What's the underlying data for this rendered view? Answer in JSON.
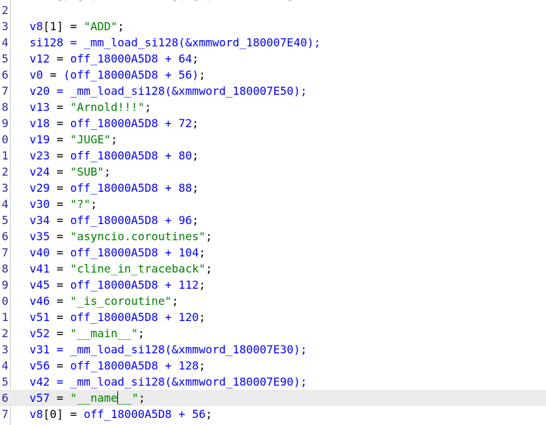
{
  "colors": {
    "background": "#ffffff",
    "variable": "#0000ff",
    "string": "#008000",
    "operator": "#000000",
    "line_number": "#2a2a96",
    "current_line": "#ebebeb"
  },
  "top_partial": "    ], [ ,           ], [ ,           ]",
  "lines": [
    {
      "num": "2",
      "tokens": []
    },
    {
      "num": "3",
      "tokens": [
        {
          "t": "v8",
          "c": "var"
        },
        {
          "t": "[1] = ",
          "c": "op"
        },
        {
          "t": "\"ADD\"",
          "c": "str"
        },
        {
          "t": ";",
          "c": "op"
        }
      ]
    },
    {
      "num": "4",
      "tokens": [
        {
          "t": "si128",
          "c": "var"
        },
        {
          "t": " = _mm_load_si128(&xmmword_180007E40);",
          "c": "var"
        }
      ]
    },
    {
      "num": "5",
      "tokens": [
        {
          "t": "v12",
          "c": "var"
        },
        {
          "t": " = ",
          "c": "op"
        },
        {
          "t": "off_18000A5D8 + 64",
          "c": "var"
        },
        {
          "t": ";",
          "c": "op"
        }
      ]
    },
    {
      "num": "6",
      "tokens": [
        {
          "t": "v0",
          "c": "var"
        },
        {
          "t": " = ",
          "c": "op"
        },
        {
          "t": "(off_18000A5D8 + 56)",
          "c": "var"
        },
        {
          "t": ";",
          "c": "op"
        }
      ]
    },
    {
      "num": "7",
      "tokens": [
        {
          "t": "v20",
          "c": "var"
        },
        {
          "t": " = _mm_load_si128(&xmmword_180007E50);",
          "c": "var"
        }
      ]
    },
    {
      "num": "8",
      "tokens": [
        {
          "t": "v13",
          "c": "var"
        },
        {
          "t": " = ",
          "c": "op"
        },
        {
          "t": "\"Arnold!!!\"",
          "c": "str"
        },
        {
          "t": ";",
          "c": "op"
        }
      ]
    },
    {
      "num": "9",
      "tokens": [
        {
          "t": "v18",
          "c": "var"
        },
        {
          "t": " = ",
          "c": "op"
        },
        {
          "t": "off_18000A5D8 + 72",
          "c": "var"
        },
        {
          "t": ";",
          "c": "op"
        }
      ]
    },
    {
      "num": "0",
      "tokens": [
        {
          "t": "v19",
          "c": "var"
        },
        {
          "t": " = ",
          "c": "op"
        },
        {
          "t": "\"JUGE\"",
          "c": "str"
        },
        {
          "t": ";",
          "c": "op"
        }
      ]
    },
    {
      "num": "1",
      "tokens": [
        {
          "t": "v23",
          "c": "var"
        },
        {
          "t": " = ",
          "c": "op"
        },
        {
          "t": "off_18000A5D8 + 80",
          "c": "var"
        },
        {
          "t": ";",
          "c": "op"
        }
      ]
    },
    {
      "num": "2",
      "tokens": [
        {
          "t": "v24",
          "c": "var"
        },
        {
          "t": " = ",
          "c": "op"
        },
        {
          "t": "\"SUB\"",
          "c": "str"
        },
        {
          "t": ";",
          "c": "op"
        }
      ]
    },
    {
      "num": "3",
      "tokens": [
        {
          "t": "v29",
          "c": "var"
        },
        {
          "t": " = ",
          "c": "op"
        },
        {
          "t": "off_18000A5D8 + 88",
          "c": "var"
        },
        {
          "t": ";",
          "c": "op"
        }
      ]
    },
    {
      "num": "4",
      "tokens": [
        {
          "t": "v30",
          "c": "var"
        },
        {
          "t": " = ",
          "c": "op"
        },
        {
          "t": "\"?\"",
          "c": "str"
        },
        {
          "t": ";",
          "c": "op"
        }
      ]
    },
    {
      "num": "5",
      "tokens": [
        {
          "t": "v34",
          "c": "var"
        },
        {
          "t": " = ",
          "c": "op"
        },
        {
          "t": "off_18000A5D8 + 96",
          "c": "var"
        },
        {
          "t": ";",
          "c": "op"
        }
      ]
    },
    {
      "num": "6",
      "tokens": [
        {
          "t": "v35",
          "c": "var"
        },
        {
          "t": " = ",
          "c": "op"
        },
        {
          "t": "\"asyncio.coroutines\"",
          "c": "str"
        },
        {
          "t": ";",
          "c": "op"
        }
      ]
    },
    {
      "num": "7",
      "tokens": [
        {
          "t": "v40",
          "c": "var"
        },
        {
          "t": " = ",
          "c": "op"
        },
        {
          "t": "off_18000A5D8 + 104",
          "c": "var"
        },
        {
          "t": ";",
          "c": "op"
        }
      ]
    },
    {
      "num": "8",
      "tokens": [
        {
          "t": "v41",
          "c": "var"
        },
        {
          "t": " = ",
          "c": "op"
        },
        {
          "t": "\"cline_in_traceback\"",
          "c": "str"
        },
        {
          "t": ";",
          "c": "op"
        }
      ]
    },
    {
      "num": "9",
      "tokens": [
        {
          "t": "v45",
          "c": "var"
        },
        {
          "t": " = ",
          "c": "op"
        },
        {
          "t": "off_18000A5D8 + 112",
          "c": "var"
        },
        {
          "t": ";",
          "c": "op"
        }
      ]
    },
    {
      "num": "0",
      "tokens": [
        {
          "t": "v46",
          "c": "var"
        },
        {
          "t": " = ",
          "c": "op"
        },
        {
          "t": "\"_is_coroutine\"",
          "c": "str"
        },
        {
          "t": ";",
          "c": "op"
        }
      ]
    },
    {
      "num": "1",
      "tokens": [
        {
          "t": "v51",
          "c": "var"
        },
        {
          "t": " = ",
          "c": "op"
        },
        {
          "t": "off_18000A5D8 + 120",
          "c": "var"
        },
        {
          "t": ";",
          "c": "op"
        }
      ]
    },
    {
      "num": "2",
      "tokens": [
        {
          "t": "v52",
          "c": "var"
        },
        {
          "t": " = ",
          "c": "op"
        },
        {
          "t": "\"__main__\"",
          "c": "str"
        },
        {
          "t": ";",
          "c": "op"
        }
      ]
    },
    {
      "num": "3",
      "tokens": [
        {
          "t": "v31",
          "c": "var"
        },
        {
          "t": " = _mm_load_si128(&xmmword_180007E30);",
          "c": "var"
        }
      ]
    },
    {
      "num": "4",
      "tokens": [
        {
          "t": "v56",
          "c": "var"
        },
        {
          "t": " = ",
          "c": "op"
        },
        {
          "t": "off_18000A5D8 + 128",
          "c": "var"
        },
        {
          "t": ";",
          "c": "op"
        }
      ]
    },
    {
      "num": "5",
      "tokens": [
        {
          "t": "v42",
          "c": "var"
        },
        {
          "t": " = _mm_load_si128(&xmmword_180007E90);",
          "c": "var"
        }
      ]
    },
    {
      "num": "6",
      "current": true,
      "tokens": [
        {
          "t": "v57",
          "c": "var"
        },
        {
          "t": " = ",
          "c": "op"
        },
        {
          "t": "\"__name",
          "c": "str"
        },
        {
          "t": "|",
          "c": "cursor"
        },
        {
          "t": "__\"",
          "c": "str"
        },
        {
          "t": ";",
          "c": "op"
        }
      ]
    },
    {
      "num": "7",
      "tokens": [
        {
          "t": "v8",
          "c": "var"
        },
        {
          "t": "[0] = ",
          "c": "op"
        },
        {
          "t": "off_18000A5D8 + 56",
          "c": "var"
        },
        {
          "t": ";",
          "c": "op"
        }
      ]
    }
  ]
}
